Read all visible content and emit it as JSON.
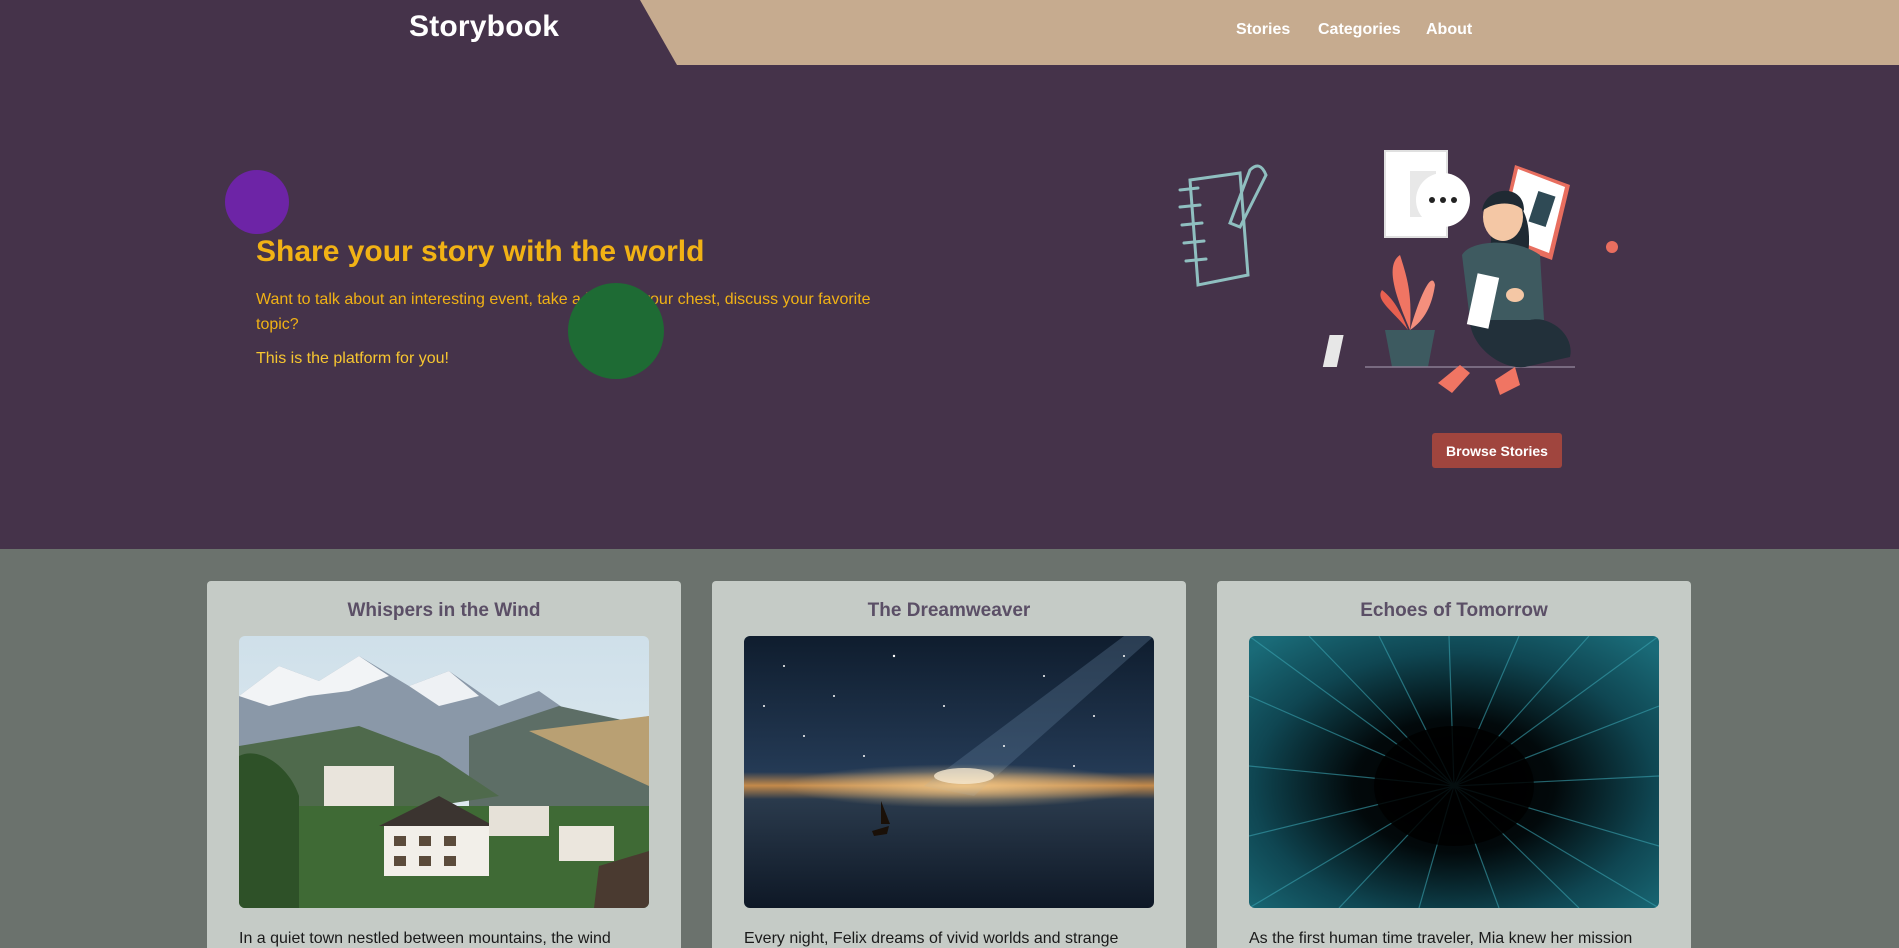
{
  "header": {
    "brand": "Storybook",
    "nav": [
      "Stories",
      "Categories",
      "About"
    ]
  },
  "hero": {
    "title": "Share your story with the world",
    "text": "Want to talk about an interesting event, take a load off your chest, discuss your favorite topic?",
    "text2": "This is the platform for you!",
    "button": "Browse Stories"
  },
  "stories": [
    {
      "title": "Whispers in the Wind",
      "excerpt": "In a quiet town nestled between mountains, the wind",
      "image": "mountain-village-photo"
    },
    {
      "title": "The Dreamweaver",
      "excerpt": "Every night, Felix dreams of vivid worlds and strange",
      "image": "starry-sea-sailboat-photo"
    },
    {
      "title": "Echoes of Tomorrow",
      "excerpt": "As the first human time traveler, Mia knew her mission",
      "image": "warp-tunnel-photo"
    }
  ],
  "colors": {
    "header_bg": "#c6ab8f",
    "hero_bg": "#45334a",
    "accent": "#f1b215",
    "button": "#a0453e",
    "section_bg": "#6b726d",
    "card_bg": "#c5cbc6"
  }
}
